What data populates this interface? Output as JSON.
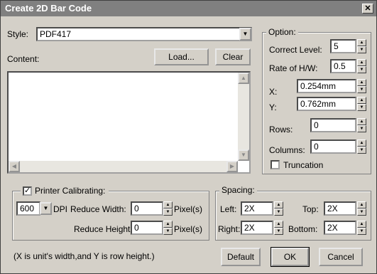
{
  "window": {
    "title": "Create 2D Bar Code",
    "close_glyph": "✕"
  },
  "style": {
    "label": "Style:",
    "value": "PDF417"
  },
  "content": {
    "label": "Content:",
    "value": "",
    "load_label": "Load...",
    "clear_label": "Clear"
  },
  "option": {
    "title": "Option:",
    "correct_level": {
      "label": "Correct Level:",
      "value": "5"
    },
    "rate_hw": {
      "label": "Rate of H/W:",
      "value": "0.5"
    },
    "x": {
      "label": "X:",
      "value": "0.254mm"
    },
    "y": {
      "label": "Y:",
      "value": "0.762mm"
    },
    "rows": {
      "label": "Rows:",
      "value": "0"
    },
    "columns": {
      "label": "Columns:",
      "value": "0"
    },
    "truncation": {
      "label": "Truncation",
      "checked": false
    }
  },
  "printer": {
    "check_label": "Printer Calibrating:",
    "checked": true,
    "dpi_value": "600",
    "dpi_label": "DPI",
    "reduce_width": {
      "label": "Reduce  Width:",
      "value": "0",
      "unit": "Pixel(s)"
    },
    "reduce_height": {
      "label": "Reduce  Height:",
      "value": "0",
      "unit": "Pixel(s)"
    }
  },
  "spacing": {
    "title": "Spacing:",
    "left": {
      "label": "Left:",
      "value": "2X"
    },
    "top": {
      "label": "Top:",
      "value": "2X"
    },
    "right": {
      "label": "Right:",
      "value": "2X"
    },
    "bottom": {
      "label": "Bottom:",
      "value": "2X"
    }
  },
  "footer": {
    "note": "(X is unit's width,and Y is row height.)",
    "default_label": "Default",
    "ok_label": "OK",
    "cancel_label": "Cancel"
  },
  "glyphs": {
    "check": "✓",
    "down": "▼",
    "up": "▲",
    "left": "◀",
    "right": "▶"
  }
}
